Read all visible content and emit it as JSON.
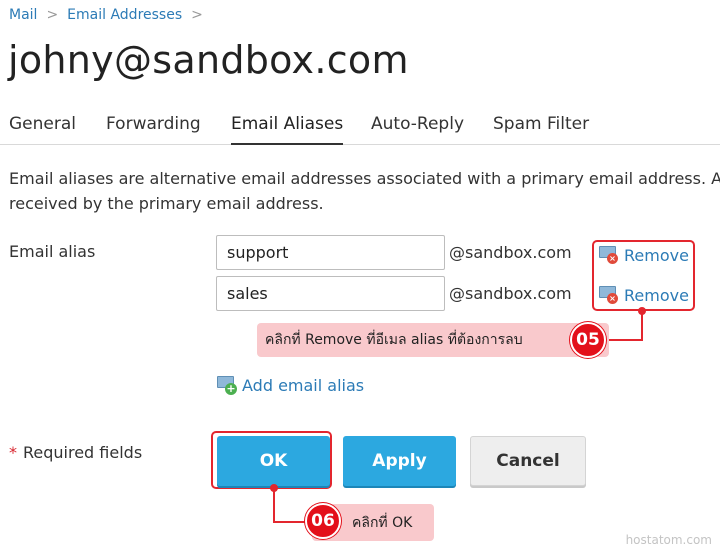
{
  "breadcrumb": {
    "items": [
      "Mail",
      "Email Addresses"
    ],
    "separator": ">"
  },
  "page_title": "johny@sandbox.com",
  "tabs": [
    {
      "label": "General",
      "active": false
    },
    {
      "label": "Forwarding",
      "active": false
    },
    {
      "label": "Email Aliases",
      "active": true
    },
    {
      "label": "Auto-Reply",
      "active": false
    },
    {
      "label": "Spam Filter",
      "active": false
    }
  ],
  "description": {
    "line1": "Email aliases are alternative email addresses associated with a primary email address. A",
    "line2": "received by the primary email address."
  },
  "alias_section": {
    "label": "Email alias",
    "aliases": [
      {
        "value": "support",
        "domain": "@sandbox.com",
        "remove_label": "Remove"
      },
      {
        "value": "sales",
        "domain": "@sandbox.com",
        "remove_label": "Remove"
      }
    ],
    "add_label": "Add email alias"
  },
  "form": {
    "required_star": "*",
    "required_label": "Required fields",
    "ok_label": "OK",
    "apply_label": "Apply",
    "cancel_label": "Cancel"
  },
  "annotations": {
    "step05": {
      "number": "05",
      "text": "คลิกที่ Remove ที่อีเมล alias ที่ต้องการลบ"
    },
    "step06": {
      "number": "06",
      "text": "คลิกที่ OK"
    }
  },
  "watermark": "hostatom.com",
  "colors": {
    "link": "#2c7bb6",
    "primary_button": "#2ca8e0",
    "annotation_red": "#e3262e",
    "callout_bg": "#f9c9cc"
  },
  "icons": {
    "remove": "email-remove-icon",
    "add": "email-add-icon",
    "breadcrumb_sep": "chevron-right-icon"
  }
}
